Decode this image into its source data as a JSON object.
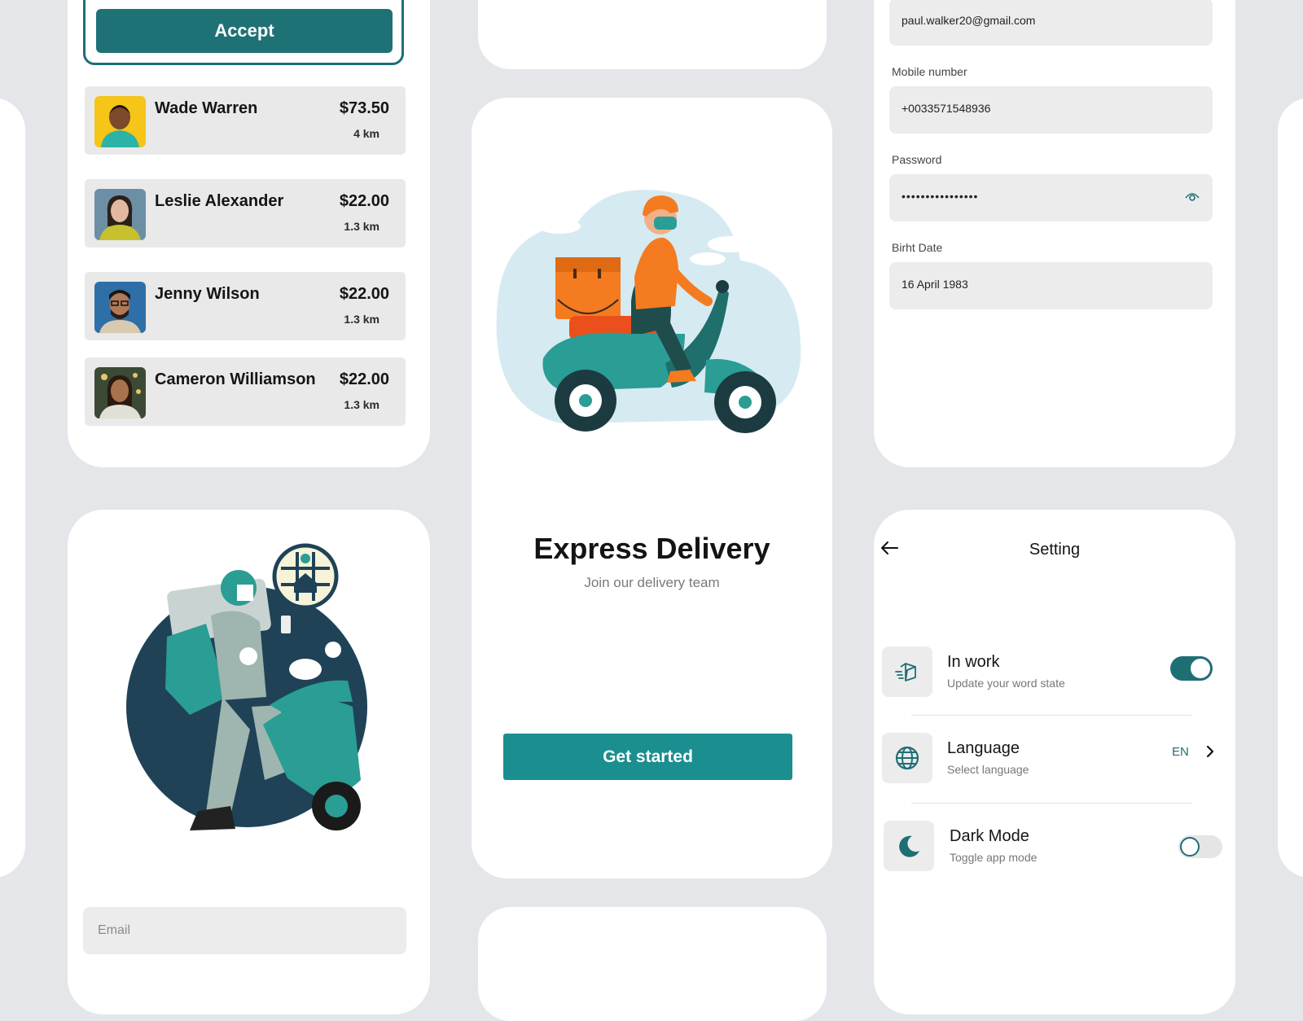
{
  "requests": {
    "accept_label": "Accept",
    "items": [
      {
        "name": "Wade Warren",
        "price": "$73.50",
        "distance": "4 km"
      },
      {
        "name": "Leslie Alexander",
        "price": "$22.00",
        "distance": "1.3 km"
      },
      {
        "name": "Jenny Wilson",
        "price": "$22.00",
        "distance": "1.3 km"
      },
      {
        "name": "Cameron Williamson",
        "price": "$22.00",
        "distance": "1.3 km"
      }
    ]
  },
  "onboarding": {
    "title": "Express Delivery",
    "subtitle": "Join our delivery team",
    "cta_label": "Get started"
  },
  "profile": {
    "email_value": "paul.walker20@gmail.com",
    "mobile_label": "Mobile number",
    "mobile_value": "+0033571548936",
    "password_label": "Password",
    "password_value": "••••••••••••••••",
    "birth_label": "Birht Date",
    "birth_value": "16 April 1983"
  },
  "settings": {
    "title": "Setting",
    "items": [
      {
        "title": "In work",
        "subtitle": "Update your word state",
        "icon": "box-icon",
        "toggle": true
      },
      {
        "title": "Language",
        "subtitle": "Select language",
        "icon": "globe-icon",
        "value": "EN"
      },
      {
        "title": "Dark Mode",
        "subtitle": "Toggle app mode",
        "icon": "moon-icon",
        "toggle": false
      }
    ]
  },
  "login": {
    "email_placeholder": "Email"
  },
  "colors": {
    "primary": "#1e7276",
    "cta": "#1b8e90",
    "scooter_teal": "#2a9d95",
    "orange": "#f47b20",
    "background": "#e4e6e9"
  }
}
